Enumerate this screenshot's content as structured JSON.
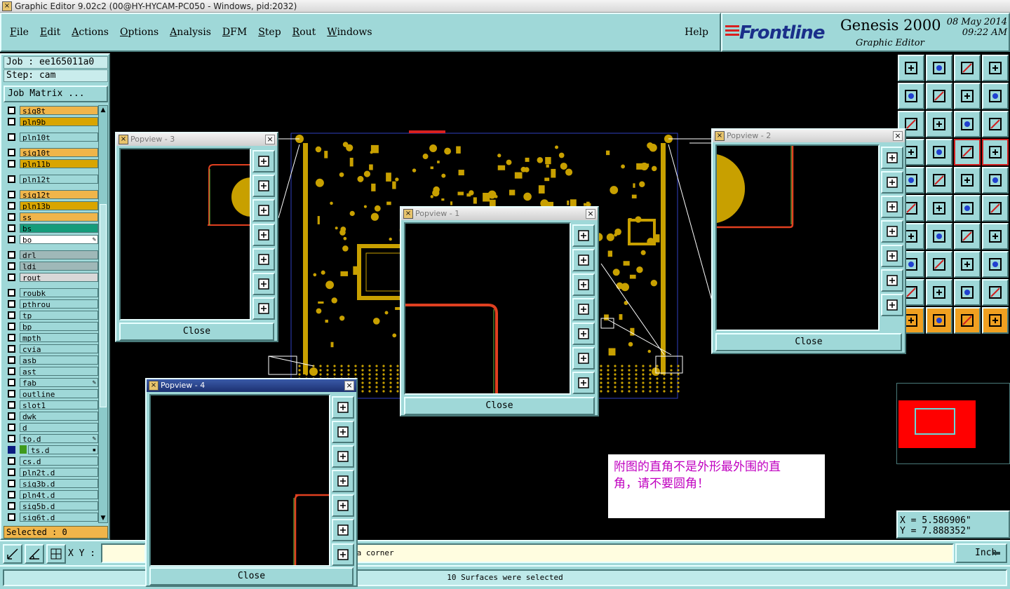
{
  "window": {
    "title": "Graphic Editor 9.02c2 (00@HY-HYCAM-PC050 - Windows, pid:2032)"
  },
  "menubar": {
    "items": [
      "File",
      "Edit",
      "Actions",
      "Options",
      "Analysis",
      "DFM",
      "Step",
      "Rout",
      "Windows"
    ],
    "help": "Help"
  },
  "brand": {
    "logo": "Frontline",
    "product": "Genesis 2000",
    "subtitle": "Graphic Editor",
    "date": "08 May 2014",
    "time": "09:22 AM"
  },
  "job": {
    "job_label": "Job : ee165011a0",
    "step_label": "Step: cam",
    "matrix_button": "Job Matrix ..."
  },
  "layers": [
    {
      "name": "sig8t",
      "color": "#f0b54a",
      "checked": false
    },
    {
      "name": "pln9b",
      "color": "#d9a500",
      "checked": false
    },
    {
      "name": "",
      "color": "",
      "checked": false,
      "gap": true
    },
    {
      "name": "pln10t",
      "color": "#9fd8d8",
      "checked": false
    },
    {
      "name": "",
      "color": "",
      "checked": false,
      "gap": true
    },
    {
      "name": "sig10t",
      "color": "#f0b54a",
      "checked": false
    },
    {
      "name": "pln11b",
      "color": "#d9a500",
      "checked": false
    },
    {
      "name": "",
      "color": "",
      "checked": false,
      "gap": true
    },
    {
      "name": "pln12t",
      "color": "#9fd8d8",
      "checked": false
    },
    {
      "name": "",
      "color": "",
      "checked": false,
      "gap": true
    },
    {
      "name": "sig12t",
      "color": "#f0b54a",
      "checked": false
    },
    {
      "name": "pln13b",
      "color": "#d9a500",
      "checked": false
    },
    {
      "name": "ss",
      "color": "#f0b54a",
      "checked": false
    },
    {
      "name": "bs",
      "color": "#159c7a",
      "checked": false
    },
    {
      "name": "bo",
      "color": "#ffffff",
      "checked": false,
      "mark": "✎"
    },
    {
      "name": "",
      "color": "",
      "checked": false,
      "gap": true
    },
    {
      "name": "drl",
      "color": "#9fb8b8",
      "checked": false
    },
    {
      "name": "ldi",
      "color": "#9fb8b8",
      "checked": false
    },
    {
      "name": "rout",
      "color": "#d8d8d8",
      "checked": false
    },
    {
      "name": "",
      "color": "",
      "checked": false,
      "gap": true
    },
    {
      "name": "roubk",
      "color": "#9fd8d8",
      "checked": false
    },
    {
      "name": "pthrou",
      "color": "#9fd8d8",
      "checked": false
    },
    {
      "name": "tp",
      "color": "#9fd8d8",
      "checked": false
    },
    {
      "name": "bp",
      "color": "#9fd8d8",
      "checked": false
    },
    {
      "name": "mpth",
      "color": "#9fd8d8",
      "checked": false
    },
    {
      "name": "cvia",
      "color": "#9fd8d8",
      "checked": false
    },
    {
      "name": "asb",
      "color": "#9fd8d8",
      "checked": false
    },
    {
      "name": "ast",
      "color": "#9fd8d8",
      "checked": false
    },
    {
      "name": "fab",
      "color": "#9fd8d8",
      "checked": false,
      "mark": "✎"
    },
    {
      "name": "outline",
      "color": "#9fd8d8",
      "checked": false
    },
    {
      "name": "slot1",
      "color": "#9fd8d8",
      "checked": false
    },
    {
      "name": "dwk",
      "color": "#9fd8d8",
      "checked": false
    },
    {
      "name": "d",
      "color": "#9fd8d8",
      "checked": false
    },
    {
      "name": "to.d",
      "color": "#9fd8d8",
      "checked": false,
      "mark": "✎"
    },
    {
      "name": "ts.d",
      "color": "#9fd8d8",
      "checked": true,
      "mark": "▪",
      "swatch": "#3f9a1c"
    },
    {
      "name": "cs.d",
      "color": "#9fd8d8",
      "checked": false
    },
    {
      "name": "pln2t.d",
      "color": "#9fd8d8",
      "checked": false
    },
    {
      "name": "sig3b.d",
      "color": "#9fd8d8",
      "checked": false
    },
    {
      "name": "pln4t.d",
      "color": "#9fd8d8",
      "checked": false
    },
    {
      "name": "sig5b.d",
      "color": "#9fd8d8",
      "checked": false
    },
    {
      "name": "sig6t.d",
      "color": "#9fd8d8",
      "checked": false
    }
  ],
  "selected": "Selected : 0",
  "coords": {
    "x": "X = 5.586906\"",
    "y": "Y = 7.888352\""
  },
  "bottom": {
    "xy_label": "X Y :",
    "xy_value": "",
    "prompt": "ea corner",
    "units": "Inch",
    "status": "10 Surfaces were selected"
  },
  "popviews": [
    {
      "id": "popview-3",
      "title": "Popview - 3",
      "close": "Close"
    },
    {
      "id": "popview-1",
      "title": "Popview - 1",
      "close": "Close"
    },
    {
      "id": "popview-2",
      "title": "Popview - 2",
      "close": "Close"
    },
    {
      "id": "popview-4",
      "title": "Popview - 4",
      "close": "Close"
    }
  ],
  "note": {
    "line1": "附图的直角不是外形最外围的直",
    "line2": "角，请不要圆角！"
  },
  "colors": {
    "panel": "#9fd8d8",
    "pad": "#c8a000",
    "trace": "#d84020",
    "outline": "#3040c0"
  }
}
